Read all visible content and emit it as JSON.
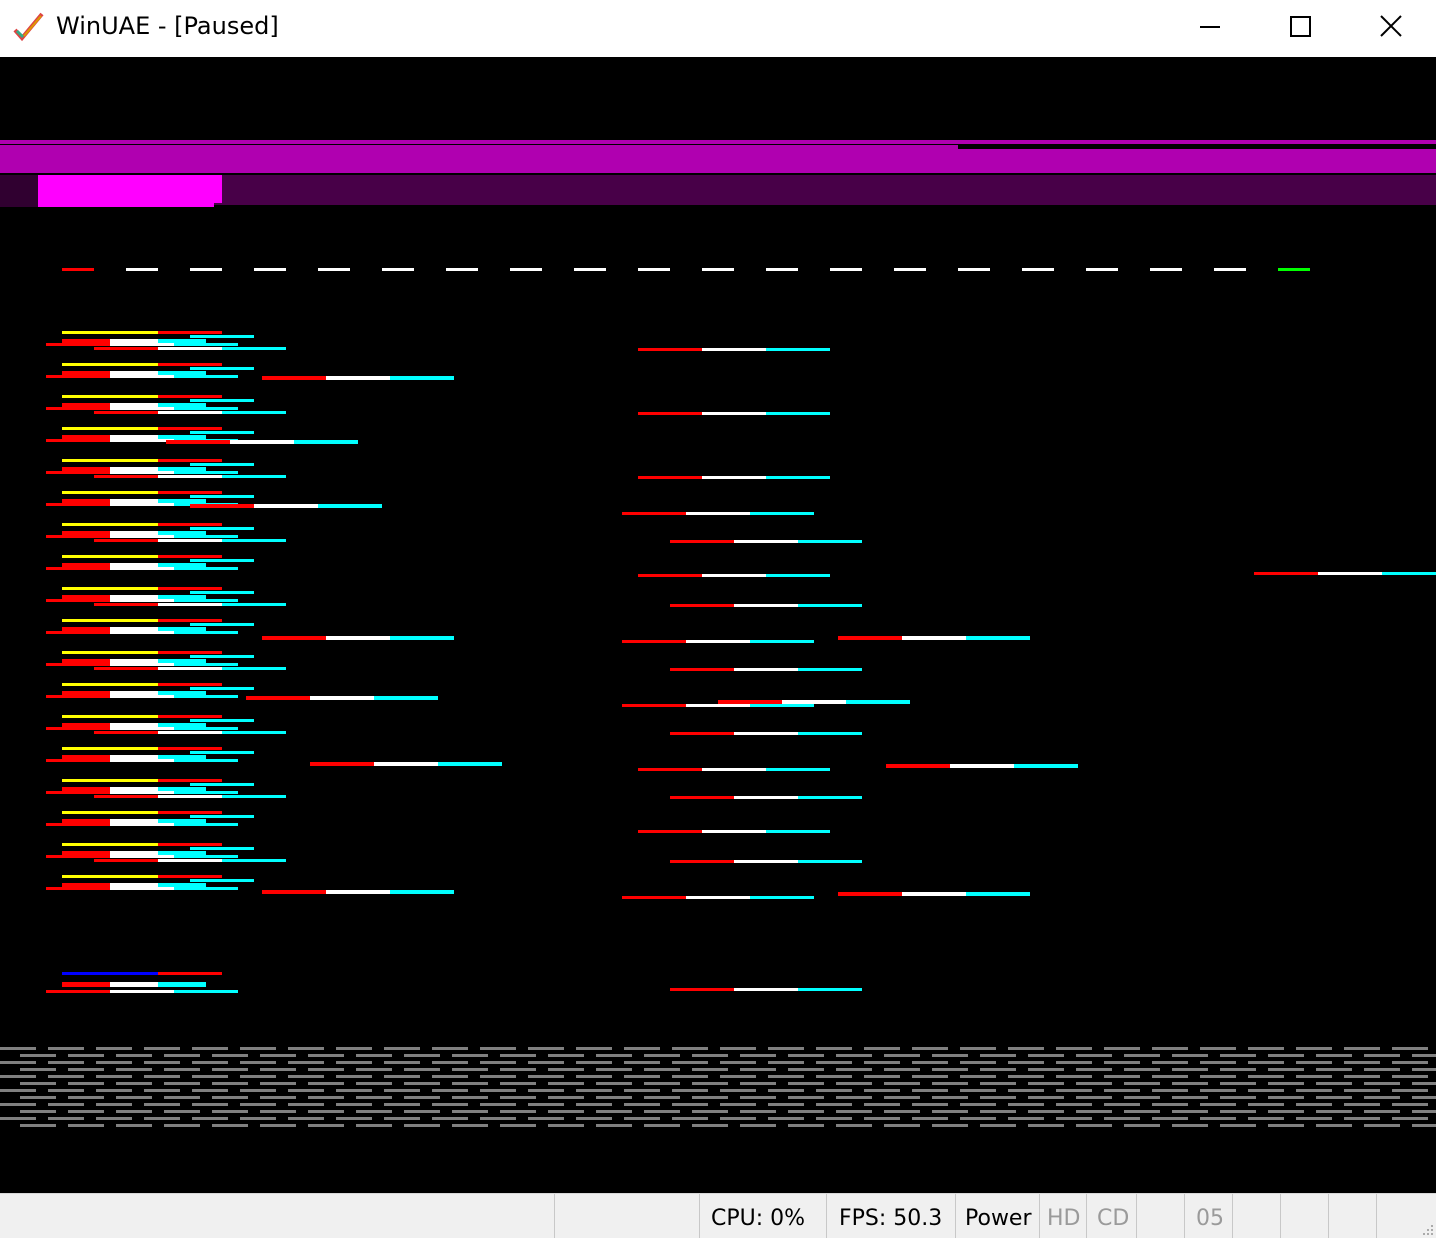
{
  "window": {
    "title": "WinUAE - [Paused]",
    "minimize_icon": "minimize-icon",
    "maximize_icon": "maximize-icon",
    "close_icon": "close-icon"
  },
  "colors": {
    "screen_bg": "#000000",
    "magenta_bar": "#b000b0",
    "magenta_bright": "#ff00ff",
    "purple_dark": "#480048",
    "red": "#ff0000",
    "yellow": "#ffff00",
    "white": "#ffffff",
    "cyan": "#00ffff",
    "blue": "#0000ff",
    "green": "#00ff00",
    "gray": "#808080"
  },
  "statusbar": {
    "cpu": "CPU: 0%",
    "fps": "FPS: 50.3",
    "power": "Power",
    "hd": "HD",
    "cd": "CD",
    "drive_df0": "05"
  }
}
